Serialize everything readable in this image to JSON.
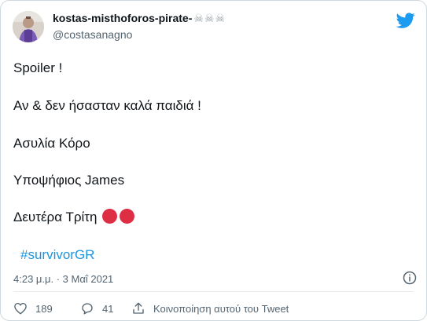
{
  "header": {
    "display_name": "kostas-misthoforos-pirate-",
    "name_emoji": "☠☠☠",
    "handle": "@costasanagno",
    "bird_icon": "twitter-bird-icon"
  },
  "tweet": {
    "lines": [
      "Spoiler !",
      "Αν & δεν ήσασταν καλά παιδιά !",
      "Ασυλία Κόρο",
      "Υποψήφιος James",
      "Δευτέρα Τρίτη"
    ],
    "emoji_icon": "red-circle-icon",
    "hashtag": "#survivorGR"
  },
  "meta": {
    "timestamp": "4:23 μ.μ. · 3 Μαΐ 2021",
    "info_icon": "info-icon"
  },
  "actions": {
    "likes": "189",
    "replies": "41",
    "share_label": "Κοινοποίηση αυτού του Tweet"
  },
  "colors": {
    "link": "#1b95e0",
    "bird": "#1d9bf0",
    "red_circle": "#dd2e44",
    "muted": "#536471"
  }
}
